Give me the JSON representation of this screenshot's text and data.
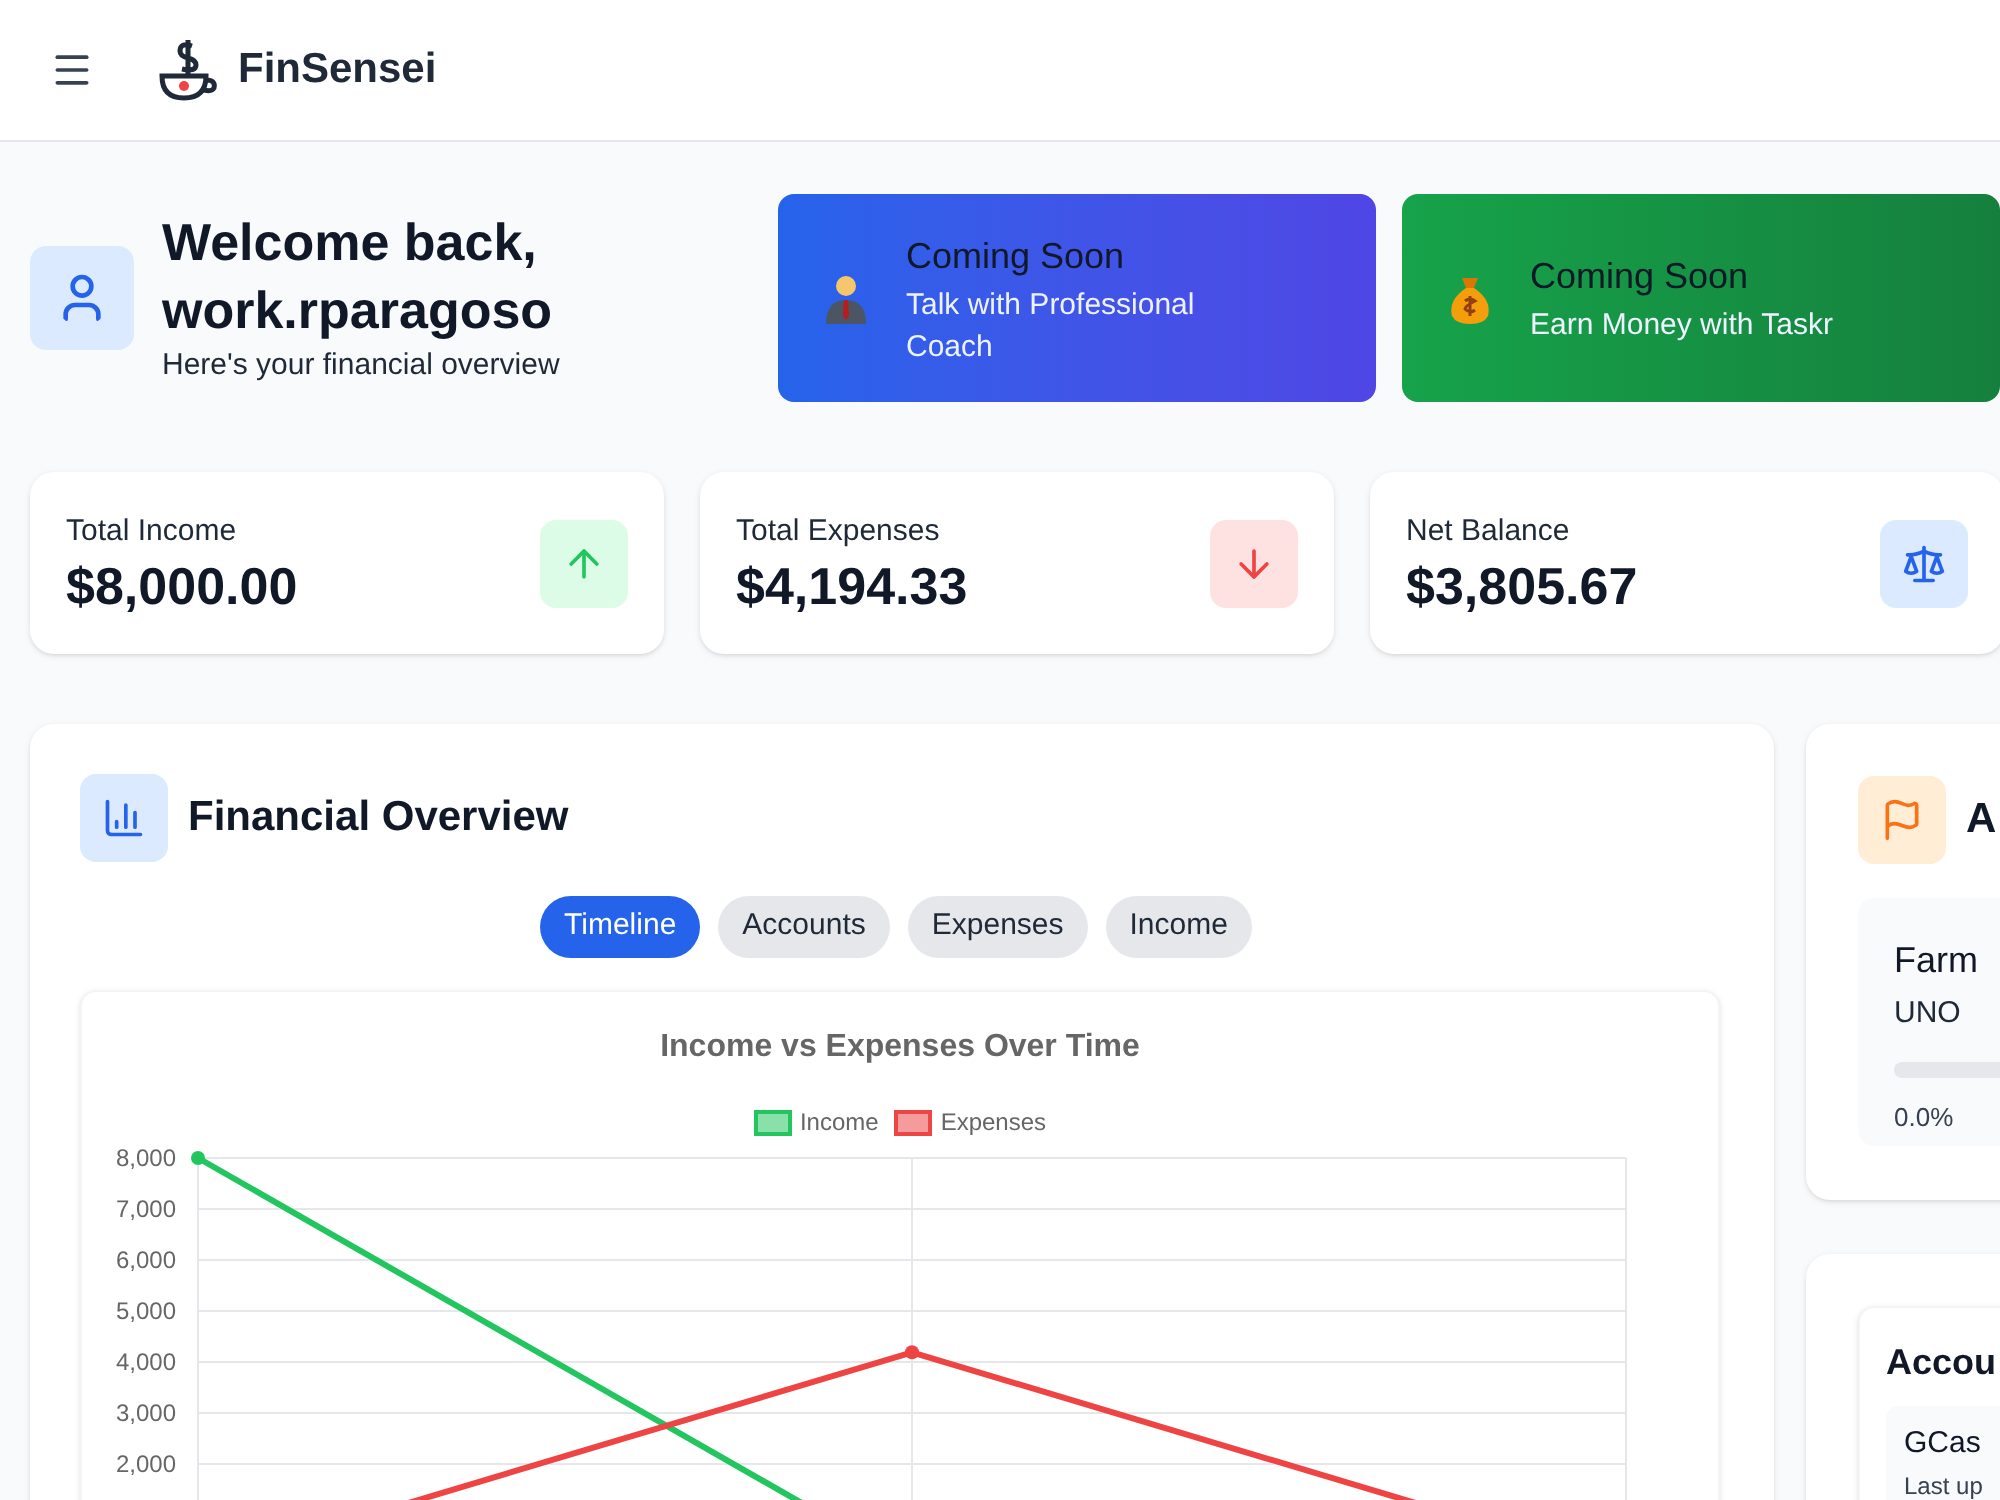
{
  "app": {
    "name": "FinSensei"
  },
  "welcome": {
    "title": "Welcome back, work.rparagoso",
    "subtitle": "Here's your financial overview"
  },
  "promos": [
    {
      "kind": "coach",
      "heading": "Coming Soon",
      "text": "Talk with Professional Coach"
    },
    {
      "kind": "money",
      "heading": "Coming Soon",
      "text": "Earn Money with Taskr"
    }
  ],
  "stats": [
    {
      "kind": "up",
      "label": "Total Income",
      "value": "$8,000.00"
    },
    {
      "kind": "down",
      "label": "Total Expenses",
      "value": "$4,194.33"
    },
    {
      "kind": "balance",
      "label": "Net Balance",
      "value": "$3,805.67"
    }
  ],
  "overview": {
    "title": "Financial Overview",
    "tabs": [
      {
        "label": "Timeline",
        "selected": true
      },
      {
        "label": "Accounts",
        "selected": false
      },
      {
        "label": "Expenses",
        "selected": false
      },
      {
        "label": "Income",
        "selected": false
      }
    ],
    "chart_data": {
      "type": "line",
      "title": "Income vs Expenses Over Time",
      "grid": true,
      "legend": "top",
      "ylim": [
        0,
        8000
      ],
      "yticks": [
        {
          "value": 2000,
          "label": "2,000"
        },
        {
          "value": 3000,
          "label": "3,000"
        },
        {
          "value": 4000,
          "label": "4,000"
        },
        {
          "value": 5000,
          "label": "5,000"
        },
        {
          "value": 6000,
          "label": "6,000"
        },
        {
          "value": 7000,
          "label": "7,000"
        },
        {
          "value": 8000,
          "label": "8,000"
        }
      ],
      "series": [
        {
          "name": "Income",
          "color": "#22c55e",
          "marker": "circle",
          "values": [
            8000,
            0,
            0
          ]
        },
        {
          "name": "Expenses",
          "color": "#ef4444",
          "marker": "circle",
          "values": [
            0,
            4190,
            0
          ]
        }
      ]
    }
  },
  "goals": {
    "title": "A",
    "items": [
      {
        "name": "Farm",
        "account": "UNO",
        "level": 0,
        "progress": "0.0%"
      }
    ]
  },
  "accounts": {
    "title": "Accou",
    "items": [
      {
        "name": "GCas",
        "updated": "Last up"
      }
    ]
  }
}
